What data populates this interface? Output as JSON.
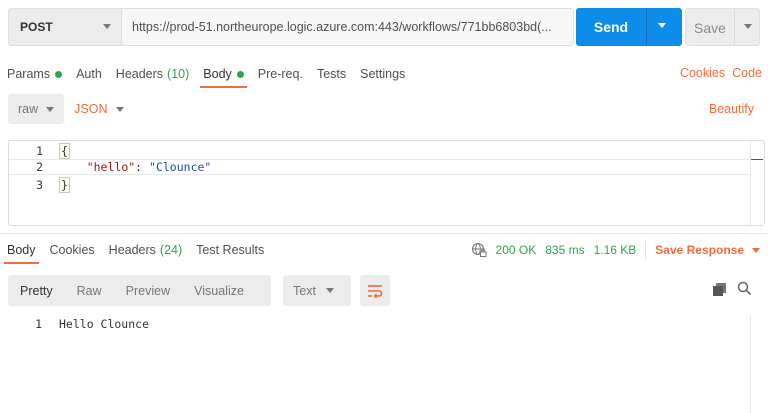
{
  "request": {
    "method": "POST",
    "url": "https://prod-51.northeurope.logic.azure.com:443/workflows/771bb6803bd(...",
    "send_label": "Send",
    "save_label": "Save"
  },
  "request_tabs": [
    {
      "label": "Params",
      "dot": true
    },
    {
      "label": "Auth"
    },
    {
      "label": "Headers",
      "count": "(10)"
    },
    {
      "label": "Body",
      "dot": true,
      "active": true
    },
    {
      "label": "Pre-req."
    },
    {
      "label": "Tests"
    },
    {
      "label": "Settings"
    }
  ],
  "right_links": {
    "cookies": "Cookies",
    "code": "Code"
  },
  "body_options": {
    "mode": "raw",
    "format": "JSON",
    "beautify": "Beautify"
  },
  "editor_lines": [
    {
      "n": "1",
      "text": "{"
    },
    {
      "n": "2",
      "key": "\"hello\"",
      "colon": ": ",
      "value": "\"Clounce\""
    },
    {
      "n": "3",
      "text": "}"
    }
  ],
  "response_tabs": [
    {
      "label": "Body",
      "active": true
    },
    {
      "label": "Cookies"
    },
    {
      "label": "Headers",
      "count": "(24)"
    },
    {
      "label": "Test Results"
    }
  ],
  "response_meta": {
    "globe_icon": "globe-lock-icon",
    "status": "200 OK",
    "time": "835 ms",
    "size": "1.16 KB",
    "save_response": "Save Response"
  },
  "view_modes": [
    "Pretty",
    "Raw",
    "Preview",
    "Visualize"
  ],
  "active_view": "Pretty",
  "response_format": "Text",
  "response_lines": [
    {
      "n": "1",
      "text": "Hello Clounce"
    }
  ],
  "colors": {
    "accent": "#f26b3a",
    "send": "#0d8de9",
    "success": "#2ea44f"
  }
}
